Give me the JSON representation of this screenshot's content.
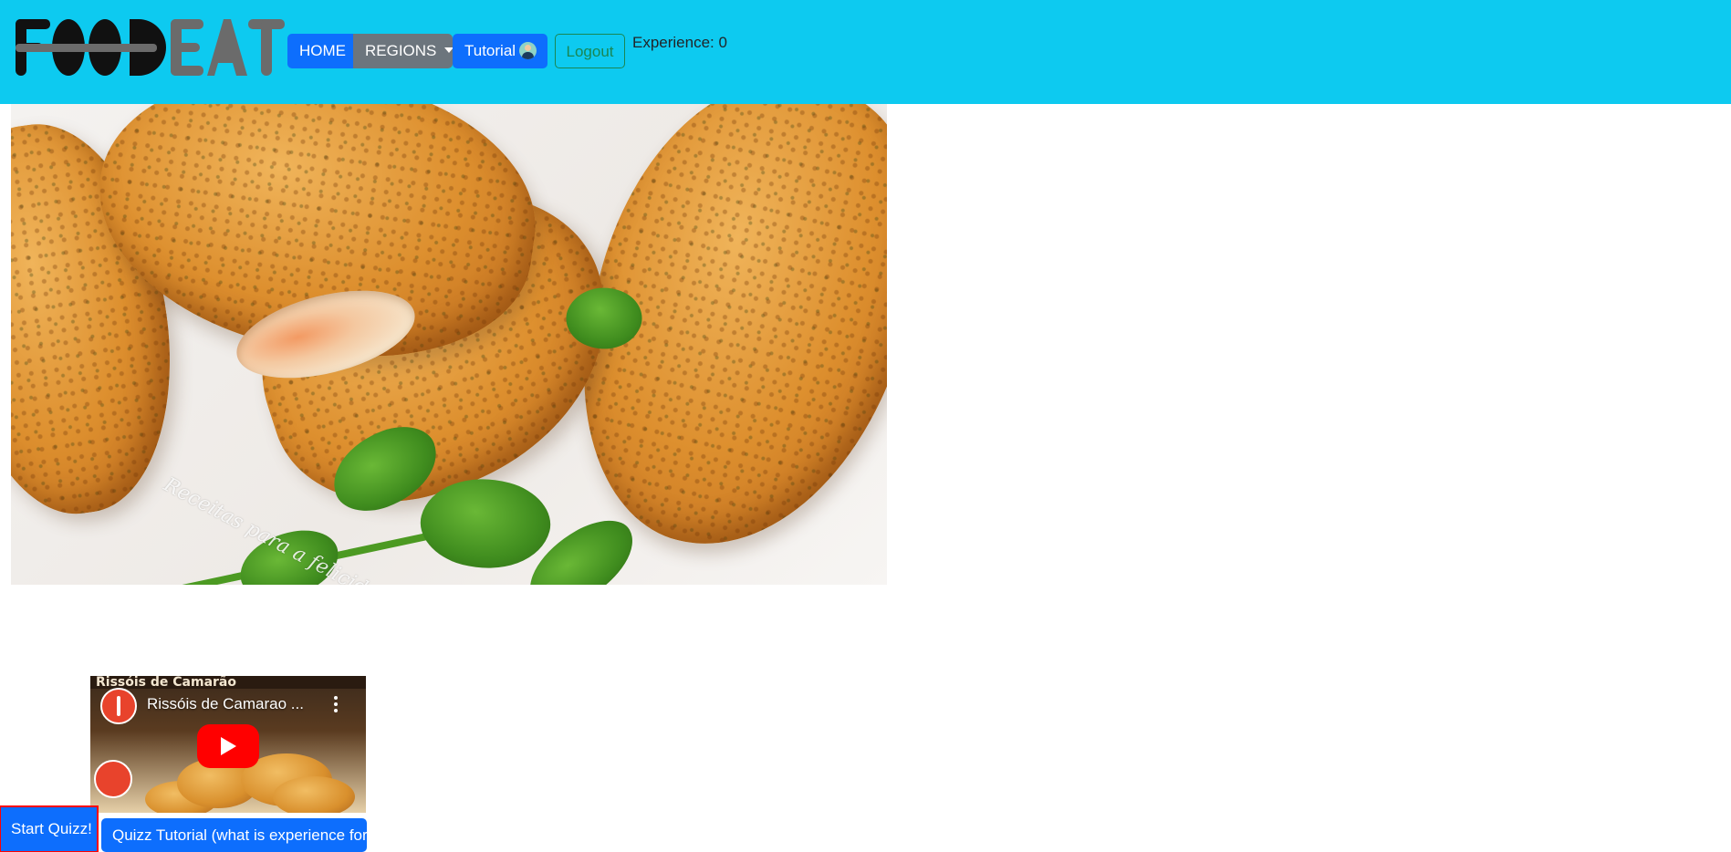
{
  "navbar": {
    "logo_text": "FOODEAT",
    "home_label": "HOME",
    "regions_label": "REGIONS",
    "tutorial_label": "Tutorial",
    "logout_label": "Logout",
    "experience_label": "Experience: 0",
    "colors": {
      "background": "#0dcaf0",
      "primary": "#0d6efd",
      "secondary": "#6c757d",
      "success": "#198754"
    }
  },
  "hero": {
    "watermark": "Receitas para a felicidade",
    "icon": "food-photo"
  },
  "video": {
    "banner_text": "Rissóis de Camarão",
    "title": "Rissóis de Camarao ...",
    "icons": [
      "channel-avatar-icon",
      "more-vert-icon",
      "youtube-play-icon"
    ]
  },
  "quiz": {
    "start_label": "Start Quizz!",
    "tutorial_label": "Quizz Tutorial (what is experience for)",
    "highlight_color": "#ff0000"
  }
}
